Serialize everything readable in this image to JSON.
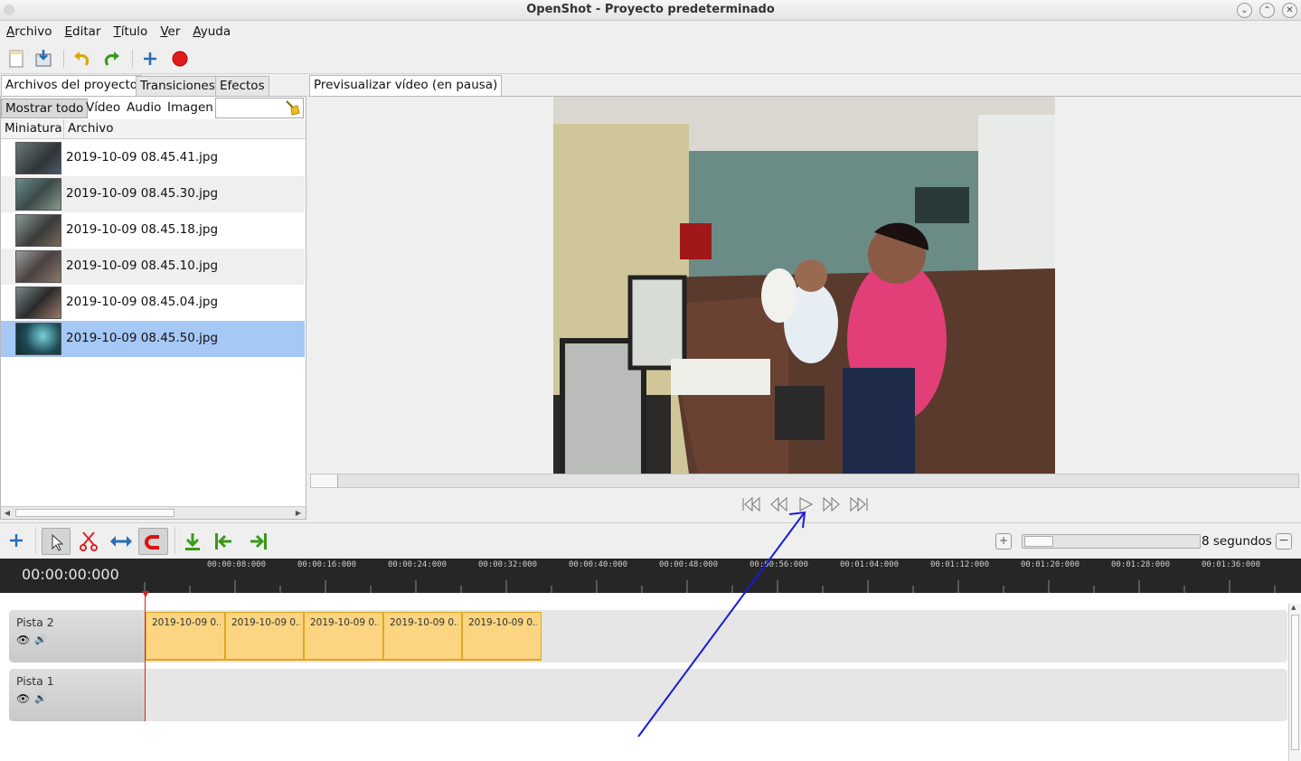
{
  "window": {
    "title": "OpenShot - Proyecto predeterminado"
  },
  "menu": [
    "Archivo",
    "Editar",
    "Título",
    "Ver",
    "Ayuda"
  ],
  "tabs_left": [
    "Archivos del proyecto",
    "Transiciones",
    "Efectos"
  ],
  "filters": [
    "Mostrar todo",
    "Vídeo",
    "Audio",
    "Imagen"
  ],
  "search": {
    "value": ""
  },
  "columns": [
    "Miniatura",
    "Archivo"
  ],
  "files": [
    {
      "name": "2019-10-09 08.45.41.jpg"
    },
    {
      "name": "2019-10-09 08.45.30.jpg"
    },
    {
      "name": "2019-10-09 08.45.18.jpg"
    },
    {
      "name": "2019-10-09 08.45.10.jpg"
    },
    {
      "name": "2019-10-09 08.45.04.jpg"
    },
    {
      "name": "2019-10-09 08.45.50.jpg",
      "selected": true
    }
  ],
  "preview": {
    "tab": "Previsualizar vídeo (en pausa)"
  },
  "timeline": {
    "timecode": "00:00:00:000",
    "zoom_label": "8 segundos",
    "ticks": [
      "00:00:08:000",
      "00:00:16:000",
      "00:00:24:000",
      "00:00:32:000",
      "00:00:40:000",
      "00:00:48:000",
      "00:00:56:000",
      "00:01:04:000",
      "00:01:12:000",
      "00:01:20:000",
      "00:01:28:000",
      "00:01:36:000"
    ],
    "tracks": [
      {
        "name": "Pista 2",
        "clips": [
          "2019-10-09 0...",
          "2019-10-09 0...",
          "2019-10-09 0...",
          "2019-10-09 0...",
          "2019-10-09 0..."
        ]
      },
      {
        "name": "Pista 1",
        "clips": []
      }
    ]
  },
  "colors": {
    "clip": "#fbd581",
    "selection": "#a6c8f5",
    "ruler_bg": "#262626",
    "annotation": "#1a1adb"
  }
}
